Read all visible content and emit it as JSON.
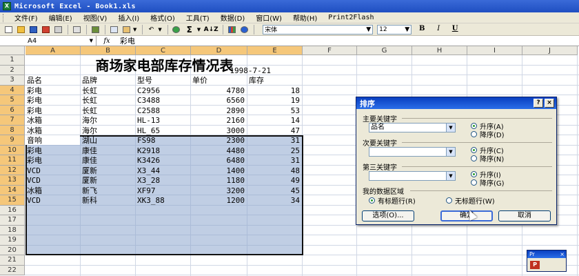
{
  "window": {
    "title": "Microsoft Excel - Book1.xls"
  },
  "menu": [
    "文件(F)",
    "编辑(E)",
    "视图(V)",
    "插入(I)",
    "格式(O)",
    "工具(T)",
    "数据(D)",
    "窗口(W)",
    "帮助(H)",
    "Print2Flash"
  ],
  "toolbar": {
    "font": "宋体",
    "size": "12",
    "sigma": "Σ",
    "sort": "A↓Z",
    "bold": "B",
    "italic": "I",
    "underline": "U"
  },
  "formula": {
    "cell": "A4",
    "fx": "fx",
    "value": "彩电"
  },
  "columns": [
    "A",
    "B",
    "C",
    "D",
    "E",
    "F",
    "G",
    "H",
    "I",
    "J"
  ],
  "rows": [
    "1",
    "2",
    "3",
    "4",
    "5",
    "6",
    "7",
    "8",
    "9",
    "10",
    "11",
    "12",
    "13",
    "14",
    "15",
    "16",
    "17",
    "18",
    "19",
    "20",
    "21",
    "22"
  ],
  "sheet": {
    "title": "商场家电部库存情况表",
    "date": "1998-7-21",
    "headers": [
      "品名",
      "品牌",
      "型号",
      "单价",
      "库存"
    ],
    "data": [
      [
        "彩电",
        "长虹",
        "C2956",
        "4780",
        "18"
      ],
      [
        "彩电",
        "长虹",
        "C3488",
        "6560",
        "19"
      ],
      [
        "彩电",
        "长虹",
        "C2588",
        "2890",
        "53"
      ],
      [
        "冰箱",
        "海尔",
        "HL-13",
        "2160",
        "14"
      ],
      [
        "冰箱",
        "海尔",
        "HL_65",
        "3000",
        "47"
      ],
      [
        "音响",
        "湖山",
        "FS98",
        "2300",
        "31"
      ],
      [
        "彩电",
        "康佳",
        "K2918",
        "4480",
        "25"
      ],
      [
        "彩电",
        "康佳",
        "K3426",
        "6480",
        "31"
      ],
      [
        "VCD",
        "厦新",
        "X3_44",
        "1400",
        "48"
      ],
      [
        "VCD",
        "厦新",
        "X3_28",
        "1180",
        "49"
      ],
      [
        "冰箱",
        "新飞",
        "XF97",
        "3200",
        "45"
      ],
      [
        "VCD",
        "新科",
        "XK3_88",
        "1200",
        "34"
      ]
    ]
  },
  "dialog": {
    "title": "排序",
    "help": "?",
    "close": "×",
    "key1_label": "主要关键字",
    "key1_value": "品名",
    "key2_label": "次要关键字",
    "key2_value": "",
    "key3_label": "第三关键字",
    "key3_value": "",
    "asc1": "升序(A)",
    "desc1": "降序(D)",
    "asc2": "升序(C)",
    "desc2": "降序(N)",
    "asc3": "升序(I)",
    "desc3": "降序(G)",
    "region_label": "我的数据区域",
    "has_header": "有标题行(R)",
    "no_header": "无标题行(W)",
    "options": "选项(O)...",
    "ok": "确定",
    "cancel": "取消"
  },
  "mini_toolbar": {
    "title": "Pr",
    "close": "×"
  }
}
